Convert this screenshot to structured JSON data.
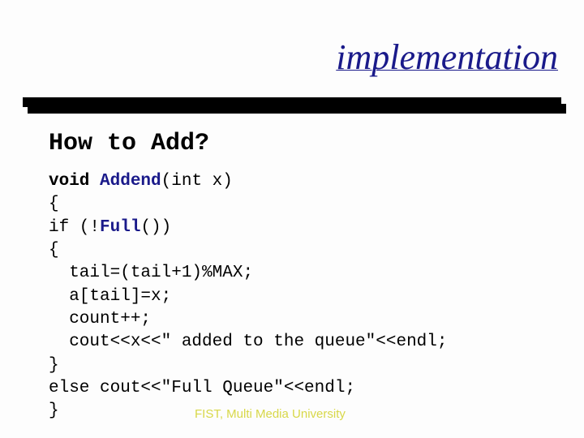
{
  "title": "implementation",
  "heading": "How to Add?",
  "code": {
    "l1_kw": "void ",
    "l1_fn": "Addend",
    "l1_rest": "(int x)",
    "l2": "{",
    "l3a": "if (!",
    "l3_fn": "Full",
    "l3b": "())",
    "l4": "{",
    "l5": "  tail=(tail+1)%MAX;",
    "l6": "  a[tail]=x;",
    "l7": "  count++;",
    "l8": "  cout<<x<<\" added to the queue\"<<endl;",
    "l9": "}",
    "l10": "else cout<<\"Full Queue\"<<endl;",
    "l11": "}"
  },
  "footer": "FIST, Multi Media University"
}
